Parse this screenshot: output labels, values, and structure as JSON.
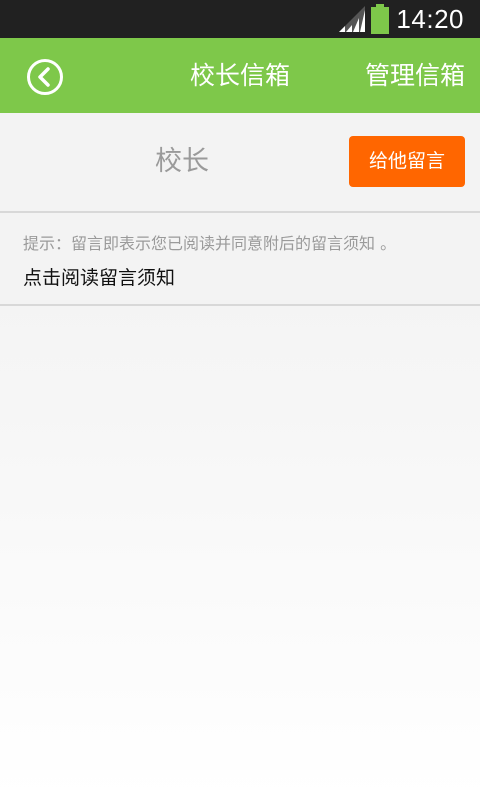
{
  "status_bar": {
    "time": "14:20",
    "icons": [
      "signal-icon",
      "battery-icon"
    ]
  },
  "app_bar": {
    "back_icon": "back-icon",
    "title": "校长信箱",
    "manage_label": "管理信箱"
  },
  "principal": {
    "name": "校长",
    "message_button_label": "给他留言"
  },
  "notice": {
    "hint": "提示：留言即表示您已阅读并同意附后的留言须知 。",
    "link": "点击阅读留言须知"
  },
  "colors": {
    "status_bar": "#212121",
    "app_bar": "#7ec84a",
    "accent_button": "#ff6600",
    "battery": "#7ec84a"
  }
}
